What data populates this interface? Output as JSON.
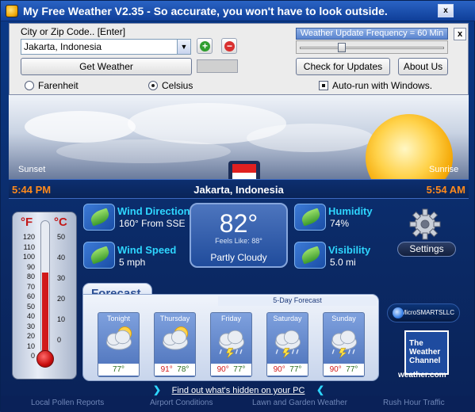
{
  "window": {
    "title": "My Free Weather V2.35 -  So accurate, you won't have to look outside.",
    "minimize_label": "x"
  },
  "controls": {
    "city_label": "City or Zip Code..  [Enter]",
    "city_value": "Jakarta, Indonesia",
    "add_label": "+",
    "remove_label": "−",
    "get_weather_label": "Get Weather",
    "farenheit_label": "Farenheit",
    "celsius_label": "Celsius",
    "unit_selected": "Celsius",
    "frequency_label": "Weather Update Frequency = 60 Min",
    "check_updates_label": "Check for Updates",
    "about_label": "About Us",
    "autorun_label": "Auto-run with Windows.",
    "autorun_checked": true,
    "close_label": "x"
  },
  "sun": {
    "sunset_label": "Sunset",
    "sunrise_label": "Sunrise",
    "sunset_time": "5:44 PM",
    "sunrise_time": "5:54 AM"
  },
  "location": "Jakarta, Indonesia",
  "thermometer": {
    "f_label": "°F",
    "c_label": "°C",
    "f_ticks": [
      "120",
      "110",
      "100",
      "90",
      "80",
      "70",
      "60",
      "50",
      "40",
      "30",
      "20",
      "10",
      "0"
    ],
    "c_ticks": [
      "50",
      "40",
      "30",
      "20",
      "10",
      "0"
    ],
    "fill_fraction": 0.62
  },
  "conditions": {
    "wind_direction_title": "Wind Direction",
    "wind_direction_value": "160° From SSE",
    "wind_speed_title": "Wind Speed",
    "wind_speed_value": "5 mph",
    "humidity_title": "Humidity",
    "humidity_value": "74%",
    "visibility_title": "Visibility",
    "visibility_value": "5.0 mi",
    "temperature": "82°",
    "feels_like": "Feels Like: 88°",
    "condition": "Partly Cloudy",
    "settings_label": "Settings"
  },
  "forecast": {
    "tab_label": "Forecast",
    "header": "5-Day Forecast",
    "days": [
      {
        "name": "Tonight",
        "hi": "",
        "lo": "77°",
        "icon": "partly-cloudy-night-icon"
      },
      {
        "name": "Thursday",
        "hi": "91°",
        "lo": "78°",
        "icon": "partly-cloudy-icon"
      },
      {
        "name": "Friday",
        "hi": "90°",
        "lo": "77°",
        "icon": "thunderstorm-icon"
      },
      {
        "name": "Saturday",
        "hi": "90°",
        "lo": "77°",
        "icon": "thunderstorm-icon"
      },
      {
        "name": "Sunday",
        "hi": "90°",
        "lo": "77°",
        "icon": "thunderstorm-icon"
      }
    ]
  },
  "branding": {
    "microsmarts": "MicroSMARTSLLC",
    "twc_line1": "The",
    "twc_line2": "Weather",
    "twc_line3": "Channel",
    "twc_url": "weather.com"
  },
  "footer": {
    "link_text": "Find out what's hidden on your PC",
    "items": [
      "Local Pollen Reports",
      "Airport Conditions",
      "Lawn and Garden Weather",
      "Rush Hour Traffic"
    ]
  },
  "colors": {
    "accent_orange": "#ff8a1c",
    "title_cyan": "#2ed6ff",
    "hi_red": "#d31b1b",
    "lo_green": "#2b6d1f"
  }
}
